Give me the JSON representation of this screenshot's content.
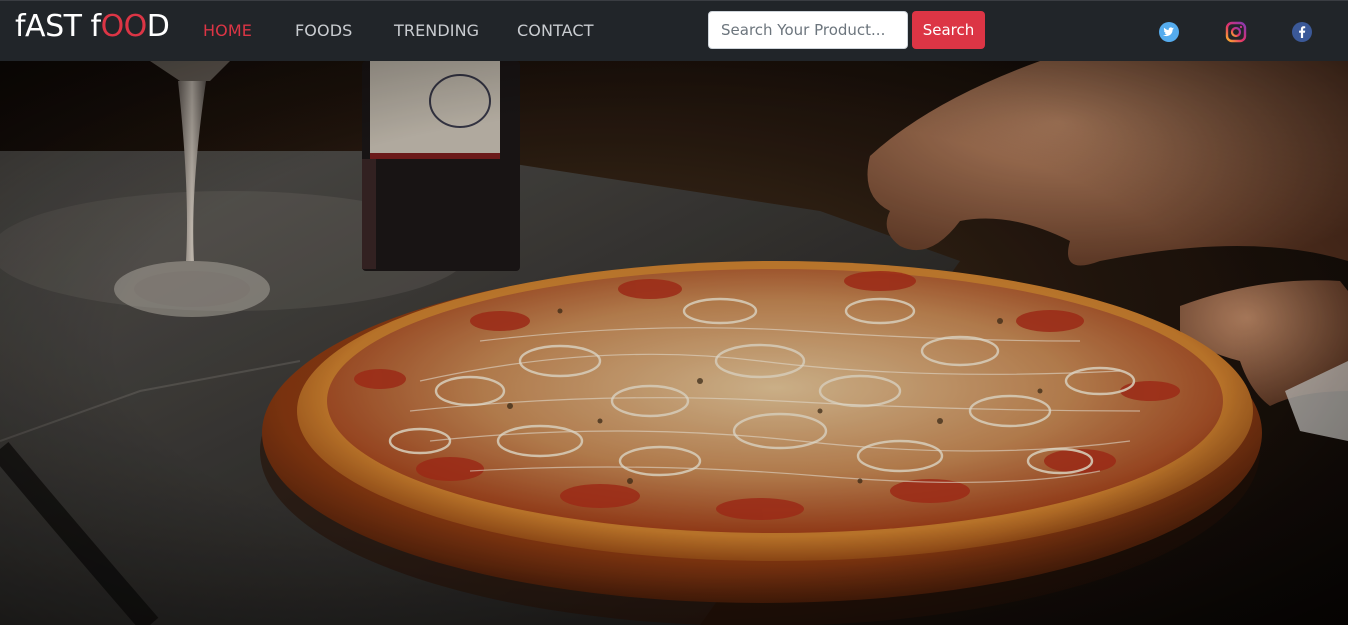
{
  "brand": {
    "part1": "fAST f",
    "part2": "OO",
    "part3": "D"
  },
  "nav": {
    "items": [
      {
        "label": "HOME",
        "active": true
      },
      {
        "label": "FOODS",
        "active": false
      },
      {
        "label": "TRENDING",
        "active": false
      },
      {
        "label": "CONTACT",
        "active": false
      }
    ]
  },
  "search": {
    "placeholder": "Search Your Product...",
    "button_label": "Search"
  },
  "social": [
    "twitter-icon",
    "instagram-icon",
    "facebook-icon"
  ],
  "colors": {
    "accent": "#dc3545",
    "navbar": "#212529"
  }
}
